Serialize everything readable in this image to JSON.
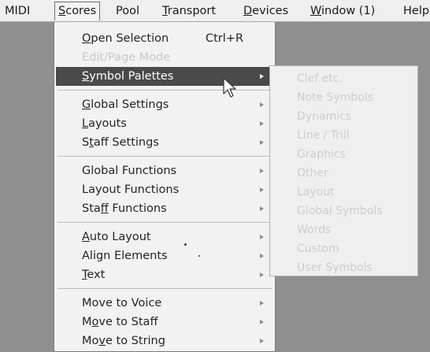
{
  "menubar": {
    "items": [
      {
        "label": "MIDI",
        "underline_index": -1
      },
      {
        "label": "Scores",
        "underline_index": 0
      },
      {
        "label": "Pool",
        "underline_index": -1
      },
      {
        "label": "Transport",
        "underline_index": 0
      },
      {
        "label": "Devices",
        "underline_index": 0
      },
      {
        "label": "Window (1)",
        "underline_index": 0
      },
      {
        "label": "Help",
        "underline_index": -1
      }
    ]
  },
  "scores_menu": {
    "items": [
      {
        "label": "Open Selection",
        "shortcut": "Ctrl+R",
        "disabled": false,
        "highlighted": false,
        "submenu": false,
        "underline_index": 0
      },
      {
        "label": "Edit/Page Mode",
        "disabled": true,
        "highlighted": false,
        "submenu": false,
        "underline_index": -1
      },
      {
        "label": "Symbol Palettes",
        "disabled": false,
        "highlighted": true,
        "submenu": true,
        "underline_index": 0
      },
      {
        "label": "Global Settings",
        "disabled": false,
        "highlighted": false,
        "submenu": true,
        "underline_index": 0
      },
      {
        "label": "Layouts",
        "disabled": false,
        "highlighted": false,
        "submenu": true,
        "underline_index": 0
      },
      {
        "label": "Staff Settings",
        "disabled": false,
        "highlighted": false,
        "submenu": true,
        "underline_index": 1
      },
      {
        "label": "Global Functions",
        "disabled": false,
        "highlighted": false,
        "submenu": true,
        "underline_index": -1
      },
      {
        "label": "Layout Functions",
        "disabled": false,
        "highlighted": false,
        "submenu": true,
        "underline_index": -1
      },
      {
        "label": "Staff Functions",
        "disabled": false,
        "highlighted": false,
        "submenu": true,
        "underline_index": 3
      },
      {
        "label": "Auto Layout",
        "disabled": false,
        "highlighted": false,
        "submenu": true,
        "underline_index": 0
      },
      {
        "label": "Align Elements",
        "disabled": false,
        "highlighted": false,
        "submenu": true,
        "underline_index": -1
      },
      {
        "label": "Text",
        "disabled": false,
        "highlighted": false,
        "submenu": true,
        "underline_index": 0
      },
      {
        "label": "Move to Voice",
        "disabled": false,
        "highlighted": false,
        "submenu": true,
        "underline_index": -1
      },
      {
        "label": "Move to Staff",
        "disabled": false,
        "highlighted": false,
        "submenu": true,
        "underline_index": 1
      },
      {
        "label": "Move to String",
        "disabled": false,
        "highlighted": false,
        "submenu": true,
        "underline_index": 2
      }
    ]
  },
  "symbol_palettes_submenu": {
    "items": [
      {
        "label": "Clef etc.",
        "disabled": true
      },
      {
        "label": "Note Symbols",
        "disabled": true
      },
      {
        "label": "Dynamics",
        "disabled": true
      },
      {
        "label": "Line / Trill",
        "disabled": true
      },
      {
        "label": "Graphics",
        "disabled": true
      },
      {
        "label": "Other",
        "disabled": true
      },
      {
        "label": "Layout",
        "disabled": true
      },
      {
        "label": "Global Symbols",
        "disabled": true
      },
      {
        "label": "Words",
        "disabled": true
      },
      {
        "label": "Custom",
        "disabled": true
      },
      {
        "label": "User Symbols",
        "disabled": true
      }
    ]
  },
  "cursor": {
    "icon": "arrow-pointer-icon"
  }
}
